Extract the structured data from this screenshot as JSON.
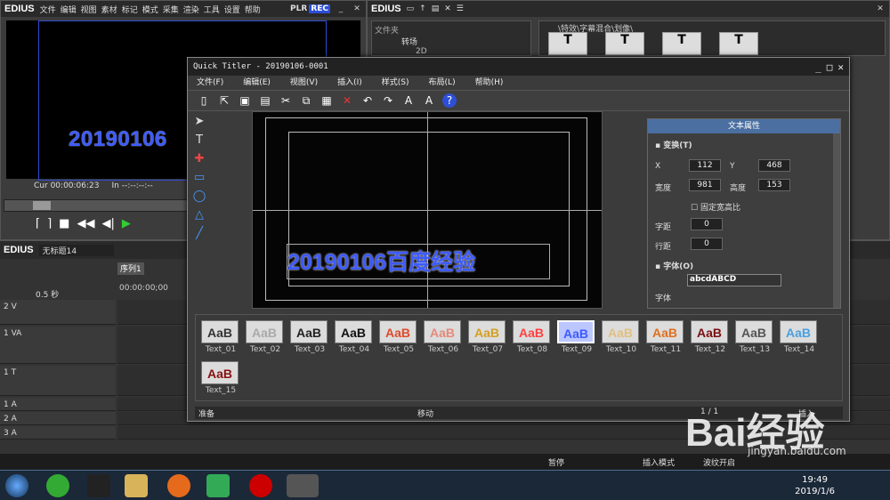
{
  "player": {
    "logo": "EDIUS",
    "menu": [
      "文件",
      "编辑",
      "视图",
      "素材",
      "标记",
      "模式",
      "采集",
      "渲染",
      "工具",
      "设置",
      "帮助"
    ],
    "plr": "PLR",
    "rec": "REC",
    "preview_text": "20190106",
    "cur_label": "Cur",
    "cur_value": "00:00:06:23",
    "in_label": "In",
    "in_value": "--:--:--:--"
  },
  "bin": {
    "logo": "EDIUS",
    "folder_header": "文件夹",
    "folder_item": "转场",
    "folder_sub": "2D",
    "path": "\\特效\\字幕混合\\划像\\"
  },
  "timeline": {
    "logo": "EDIUS",
    "project": "无标题14",
    "sequence_tab": "序列1",
    "zoom": "0.5 秒",
    "ruler_start": "00:00:00;00",
    "tracks": [
      {
        "name": "2 V"
      },
      {
        "name": "1 VA"
      },
      {
        "name": "1 T"
      },
      {
        "name": "1 A"
      },
      {
        "name": "2 A"
      },
      {
        "name": "3 A"
      }
    ]
  },
  "status_bar": {
    "state": "暂停",
    "mode": "插入模式",
    "ripple": "波纹开启"
  },
  "taskbar": {
    "time": "19:49",
    "date": "2019/1/6"
  },
  "titler": {
    "title": "Quick Titler - 20190106-0001",
    "menu": [
      "文件(F)",
      "编辑(E)",
      "视图(V)",
      "插入(I)",
      "样式(S)",
      "布局(L)",
      "帮助(H)"
    ],
    "canvas_text": "20190106百度经验",
    "props_title": "文本属性",
    "transform_label": "变换(T)",
    "x_label": "X",
    "x_value": "112",
    "y_label": "Y",
    "y_value": "468",
    "width_label": "宽度",
    "width_value": "981",
    "height_label": "高度",
    "height_value": "153",
    "lock_ratio": "固定宽高比",
    "kerning_label": "字距",
    "kerning_value": "0",
    "leading_label": "行距",
    "leading_value": "0",
    "font_section": "字体(O)",
    "font_preview": "abcdABCD",
    "font_label": "字体",
    "presets": [
      {
        "label": "Text_01",
        "sample": "AaB",
        "color": "#333333"
      },
      {
        "label": "Text_02",
        "sample": "AaB",
        "color": "#aaaaaa"
      },
      {
        "label": "Text_03",
        "sample": "AaB",
        "color": "#222222"
      },
      {
        "label": "Text_04",
        "sample": "AaB",
        "color": "#111111"
      },
      {
        "label": "Text_05",
        "sample": "AaB",
        "color": "#e04a2a"
      },
      {
        "label": "Text_06",
        "sample": "AaB",
        "color": "#e58a7a"
      },
      {
        "label": "Text_07",
        "sample": "AaB",
        "color": "#d4a020"
      },
      {
        "label": "Text_08",
        "sample": "AaB",
        "color": "#ff4040"
      },
      {
        "label": "Text_09",
        "sample": "AaB",
        "color": "#3d5bff"
      },
      {
        "label": "Text_10",
        "sample": "AaB",
        "color": "#e0c080"
      },
      {
        "label": "Text_11",
        "sample": "AaB",
        "color": "#e07020"
      },
      {
        "label": "Text_12",
        "sample": "AaB",
        "color": "#7a1010"
      },
      {
        "label": "Text_13",
        "sample": "AaB",
        "color": "#555555"
      },
      {
        "label": "Text_14",
        "sample": "AaB",
        "color": "#4aa0e0"
      },
      {
        "label": "Text_15",
        "sample": "AaB",
        "color": "#8a1010"
      }
    ],
    "selected_preset": "Text_09",
    "status_ready": "准备",
    "status_move": "移动",
    "status_page": "1 / 1",
    "status_insert": "插入"
  },
  "watermark": {
    "text": "Bai经验",
    "url": "jingyan.baidu.com"
  }
}
